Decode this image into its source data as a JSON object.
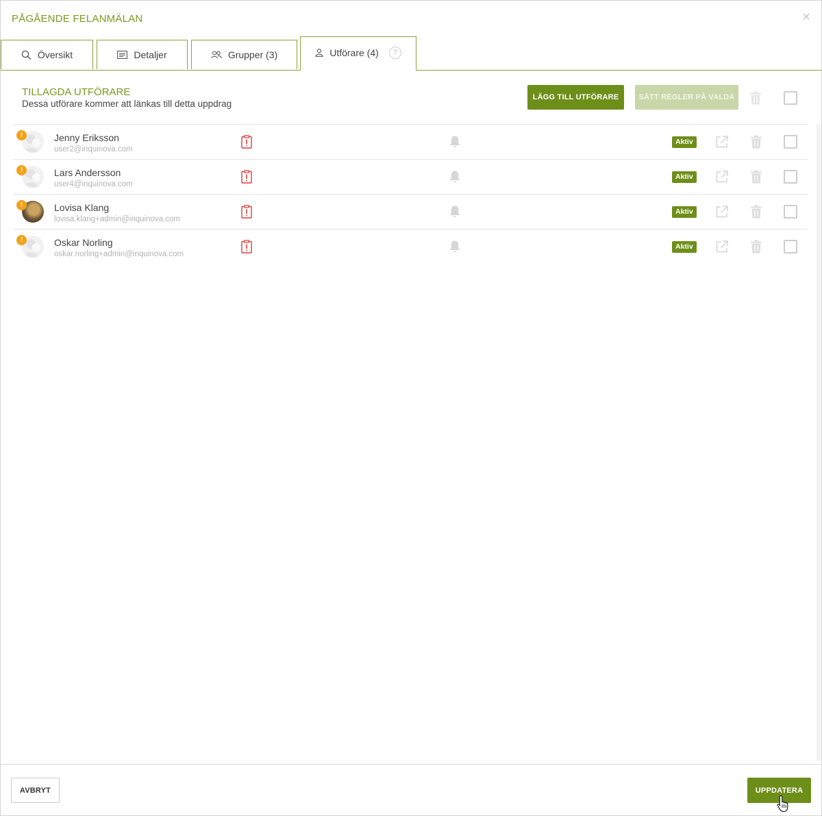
{
  "dialog": {
    "title": "PÅGÅENDE FELANMÄLAN",
    "close_icon": "×"
  },
  "tabs": [
    {
      "label": "Översikt",
      "icon": "search-icon"
    },
    {
      "label": "Detaljer",
      "icon": "list-icon"
    },
    {
      "label": "Grupper (3)",
      "icon": "group-icon"
    },
    {
      "label": "Utförare (4)",
      "icon": "user-icon",
      "active": true,
      "help": "?"
    }
  ],
  "section": {
    "title": "TILLAGDA UTFÖRARE",
    "subtitle": "Dessa utförare kommer att länkas till detta uppdrag",
    "add_button": "LÄGG TILL UTFÖRARE",
    "rules_button": "SÄTT REGLER PÅ VALDA"
  },
  "performers": [
    {
      "name": "Jenny Eriksson",
      "email": "user2@inquinova.com",
      "status": "Aktiv",
      "avatar": "placeholder"
    },
    {
      "name": "Lars Andersson",
      "email": "user4@inquinova.com",
      "status": "Aktiv",
      "avatar": "placeholder"
    },
    {
      "name": "Lovisa Klang",
      "email": "lovisa.klang+admin@inquinova.com",
      "status": "Aktiv",
      "avatar": "photo"
    },
    {
      "name": "Oskar Norling",
      "email": "oskar.norling+admin@inquinova.com",
      "status": "Aktiv",
      "avatar": "placeholder"
    }
  ],
  "warning_mark": "!",
  "footer": {
    "cancel": "AVBRYT",
    "update": "UPPDATERA"
  },
  "colors": {
    "accent": "#6e8e1a",
    "title": "#7a9a1e",
    "warning": "#f3a11b",
    "alert_red": "#d9413a"
  }
}
